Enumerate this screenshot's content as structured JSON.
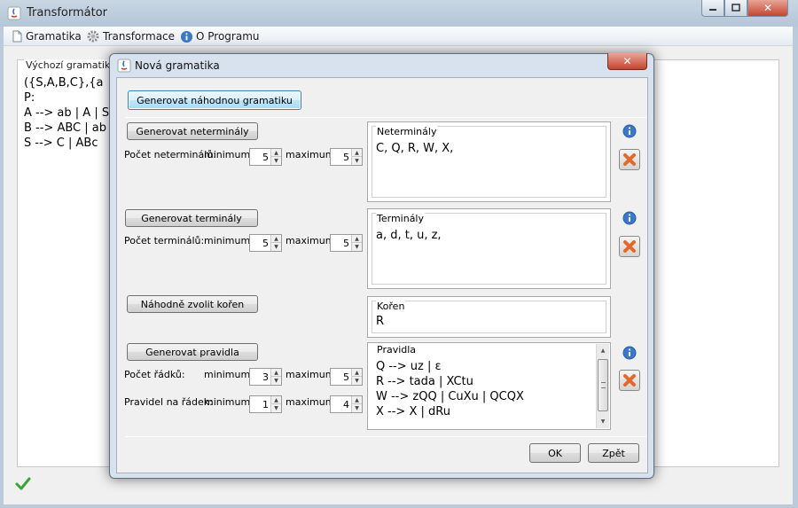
{
  "main_window": {
    "title": "Transformátor",
    "menu": [
      {
        "label": "Gramatika",
        "icon": "document-icon"
      },
      {
        "label": "Transformace",
        "icon": "gear-icon"
      },
      {
        "label": "O Programu",
        "icon": "info-icon"
      }
    ],
    "grammar_panel": {
      "title": "Výchozí gramatika",
      "lines": [
        "({S,A,B,C},{a",
        "P:",
        "A --> ab | A | S",
        "B --> ABC | ab",
        "S --> C | ABc"
      ]
    },
    "status_icon": "checkmark-icon"
  },
  "dialog": {
    "title": "Nová gramatika",
    "random_grammar_button": "Generovat náhodnou gramatiku",
    "nonterminals": {
      "button": "Generovat neterminály",
      "count_label": "Počet neterminálů:",
      "min_label": "minimum",
      "min_value": "5",
      "max_label": "maximum",
      "max_value": "5",
      "box_title": "Neterminály",
      "box_text": "C, Q, R, W, X,"
    },
    "terminals": {
      "button": "Generovat terminály",
      "count_label": "Počet terminálů:",
      "min_label": "minimum",
      "min_value": "5",
      "max_label": "maximum",
      "max_value": "5",
      "box_title": "Terminály",
      "box_text": "a, d, t, u, z,"
    },
    "root": {
      "button": "Náhodně zvolit kořen",
      "box_title": "Kořen",
      "box_text": "R"
    },
    "rules": {
      "button": "Generovat pravidla",
      "rows_label": "Počet řádků:",
      "rows_min_label": "minimum",
      "rows_min_value": "3",
      "rows_max_label": "maximum",
      "rows_max_value": "5",
      "per_row_label": "Pravidel na řádek:",
      "per_row_min_label": "minimum",
      "per_row_min_value": "1",
      "per_row_max_label": "maximum",
      "per_row_max_value": "4",
      "box_title": "Pravidla",
      "lines": [
        "Q --> uz | ε",
        "R --> tada | XCtu",
        "W --> zQQ | CuXu | QCQX",
        "X --> X | dRu"
      ]
    },
    "ok_button": "OK",
    "back_button": "Zpět"
  },
  "colors": {
    "titlebar": "#bccbdb",
    "close_button": "#c4442f",
    "info_blue": "#3b78c8",
    "delete_orange": "#e0692b",
    "check_green": "#3aa335"
  }
}
